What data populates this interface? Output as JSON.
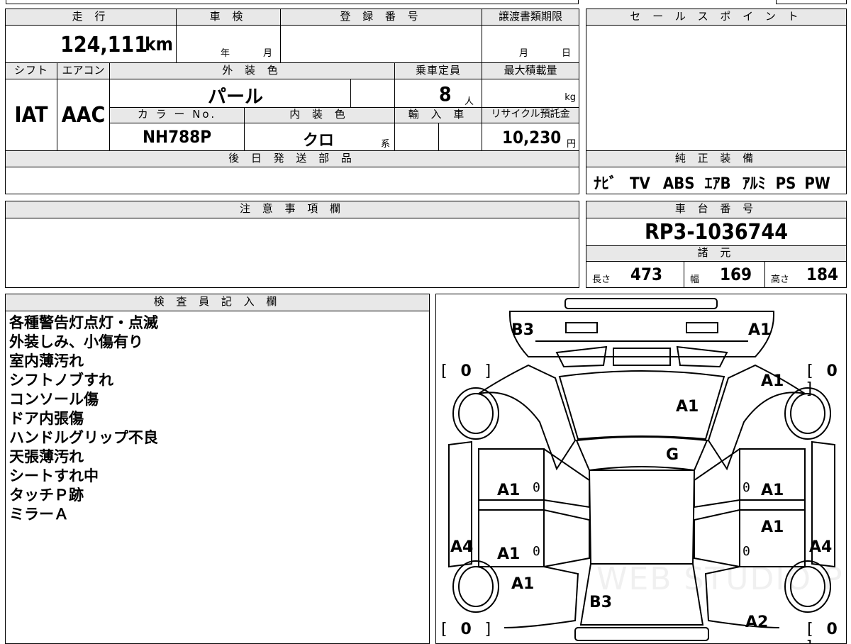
{
  "top_left": {
    "mileage_label": "走 行",
    "mileage_value": "124,111",
    "mileage_unit": "km",
    "inspection_label": "車 検",
    "inspection_year": "年",
    "inspection_month": "月",
    "registration_label": "登 録 番 号",
    "deadline_label": "譲渡書類期限",
    "deadline_month": "月",
    "deadline_day": "日",
    "shift_label": "シフト",
    "shift_value": "IAT",
    "ac_label": "エアコン",
    "ac_value": "AAC",
    "exterior_label": "外 装 色",
    "exterior_value": "パール",
    "capacity_label": "乗車定員",
    "capacity_value": "8",
    "capacity_unit": "人",
    "max_load_label": "最大積載量",
    "max_load_unit": "kg",
    "color_no_label": "カ ラ ー No.",
    "color_no_value": "NH788P",
    "interior_label": "内 装 色",
    "interior_value": "クロ",
    "interior_suffix": "系",
    "import_label": "輸 入 車",
    "recycle_label": "リサイクル預託金",
    "recycle_value": "10,230",
    "recycle_unit": "円",
    "later_parts_label": "後 日 発 送 部 品"
  },
  "sales_point": {
    "label": "セ ー ル ス ポ イ ン ト"
  },
  "equipment": {
    "label": "純 正 装 備",
    "items": [
      "ﾅﾋﾞ",
      "TV",
      "ABS",
      "ｴｱB",
      "ｱﾙﾐ",
      "PS",
      "PW"
    ]
  },
  "notes": {
    "label": "注 意 事 項 欄"
  },
  "chassis": {
    "label": "車 台 番 号",
    "value": "RP3-1036744",
    "specs_label": "諸 元",
    "length_label": "長さ",
    "length_value": "473",
    "width_label": "幅",
    "width_value": "169",
    "height_label": "高さ",
    "height_value": "184"
  },
  "inspector": {
    "label": "検 査 員 記 入 欄",
    "remarks": [
      "各種警告灯点灯・点滅",
      "外装しみ、小傷有り",
      "室内薄汚れ",
      "シフトノブすれ",
      "コンソール傷",
      "ドア内張傷",
      "ハンドルグリップ不良",
      "天張薄汚れ",
      "シートすれ中",
      "タッチＰ跡",
      "ミラーＡ"
    ]
  },
  "diagram": {
    "tire_front_left": "0",
    "tire_front_right": "0",
    "tire_rear_left": "0",
    "tire_rear_right": "0",
    "marks": {
      "front_left_corner": "B3",
      "front_right_corner": "A1",
      "right_fender": "A1",
      "hood": "A1",
      "windshield": "G",
      "left_front_door": "A1",
      "right_front_door": "A1",
      "right_rear_door_upper": "A1",
      "left_rear_door": "A1",
      "left_rocker": "A4",
      "right_rocker": "A4",
      "left_rear_quarter": "A1",
      "rear_gate": "B3",
      "right_rear_quarter": "A2",
      "door_zero_1": "0",
      "door_zero_2": "0",
      "door_zero_3": "0",
      "door_zero_4": "0"
    },
    "watermark": "WEB STUDIO PRO"
  }
}
